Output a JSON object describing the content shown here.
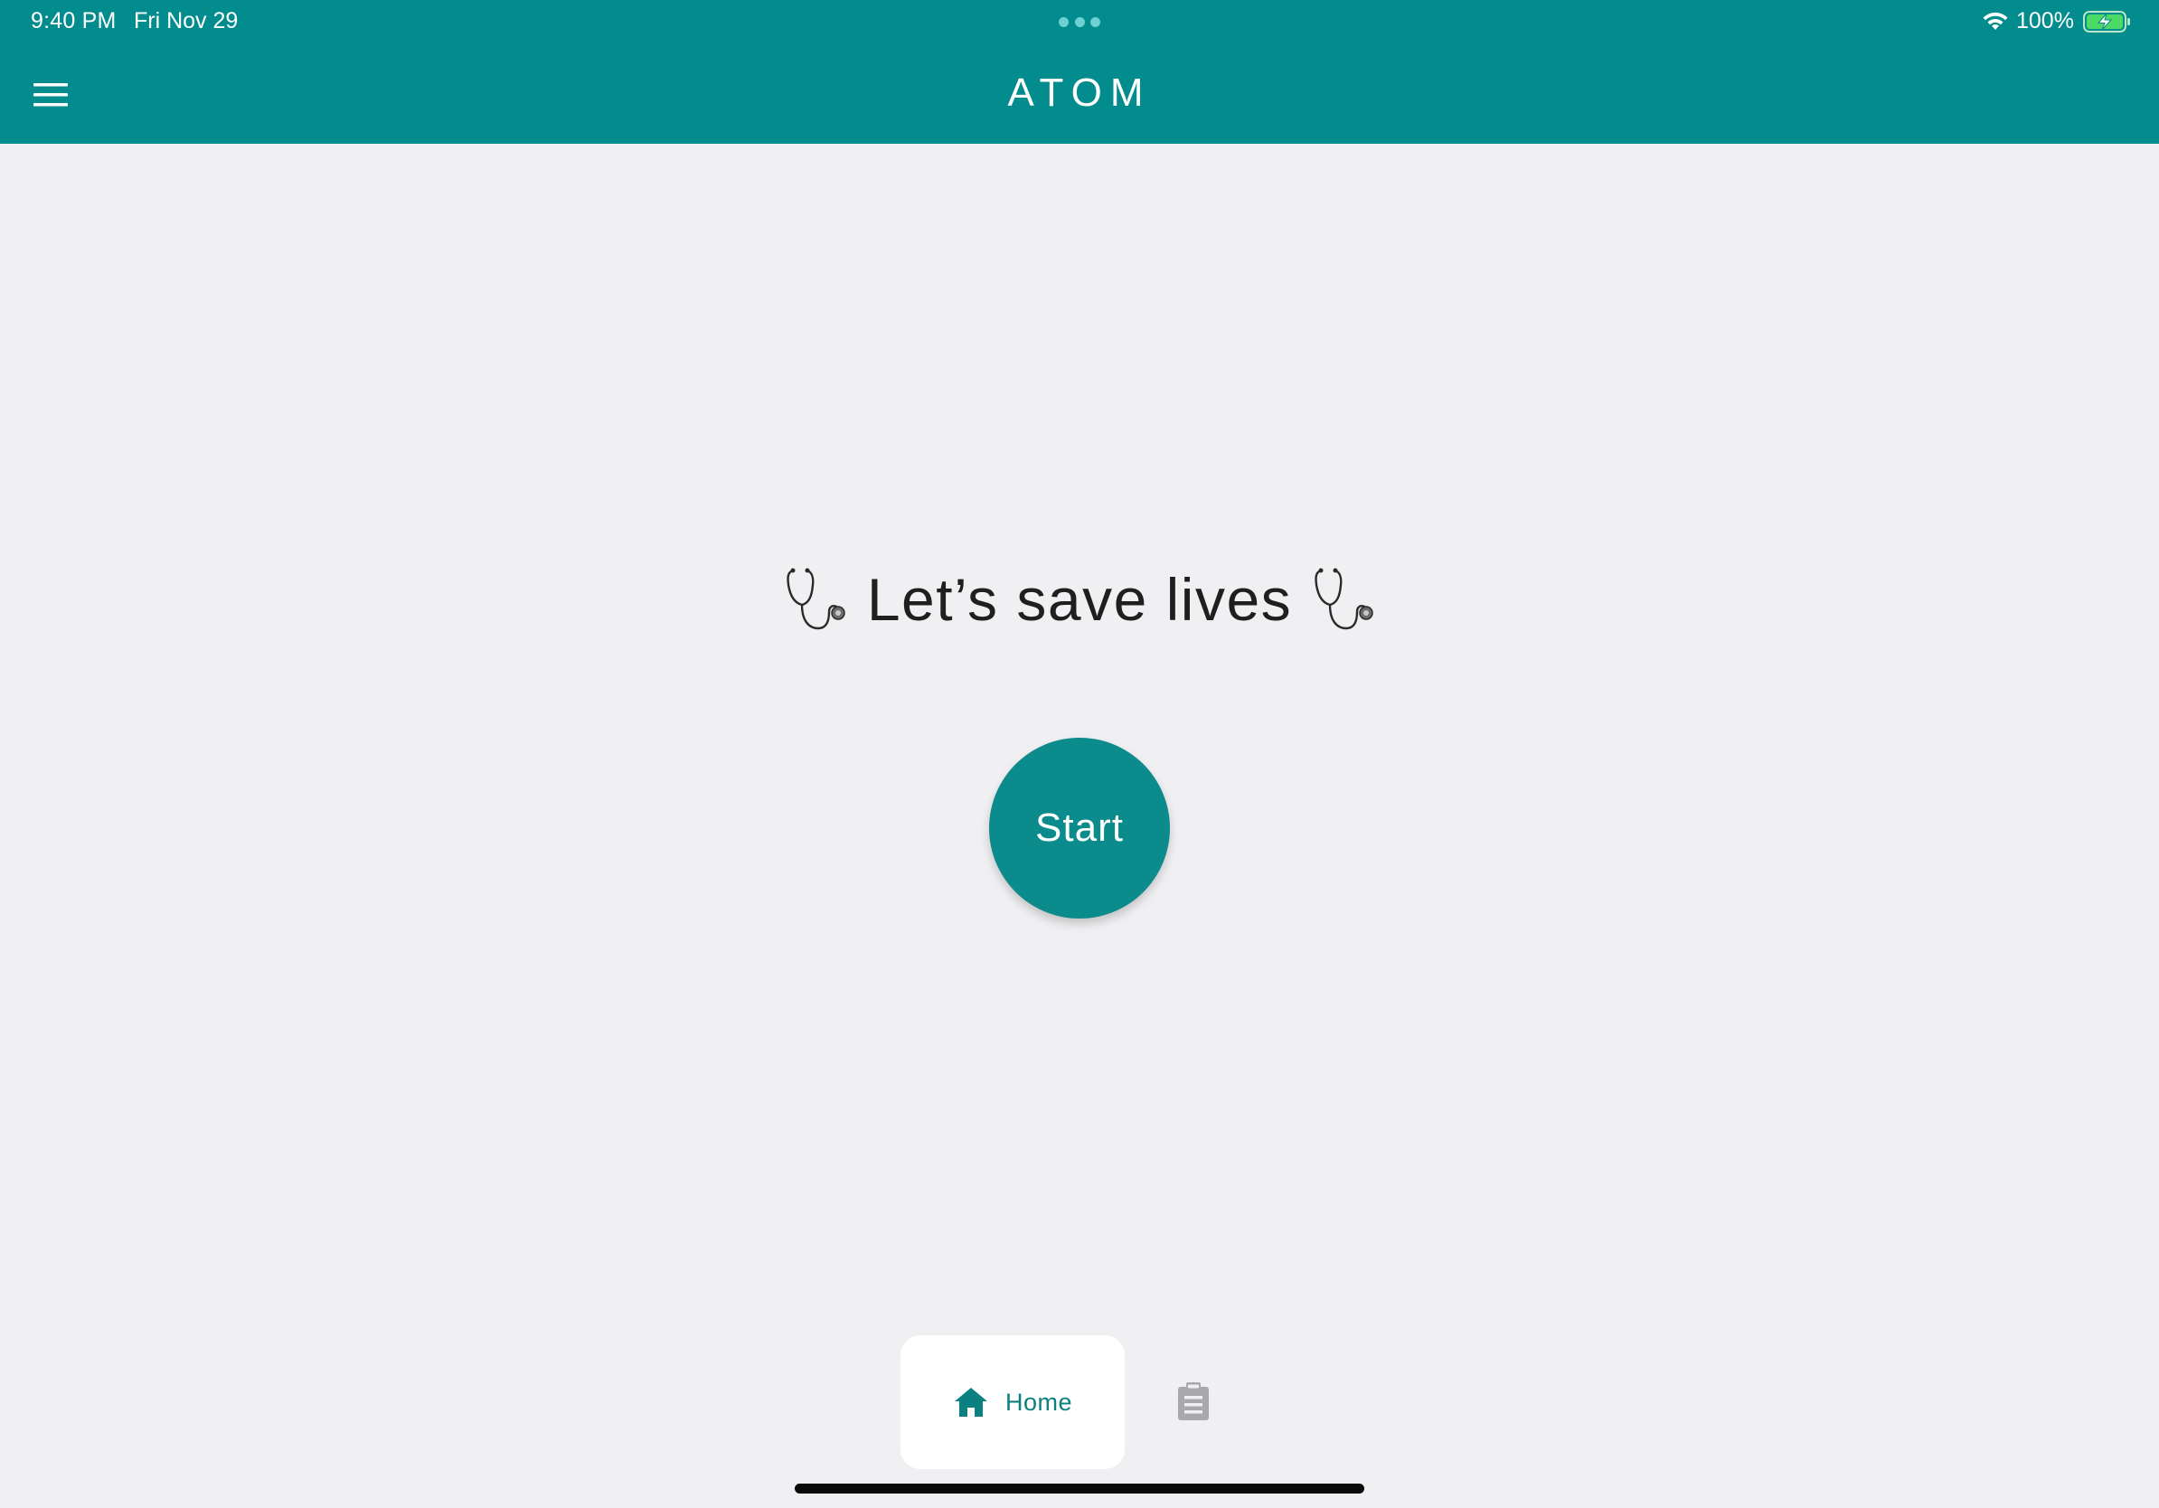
{
  "status_bar": {
    "time": "9:40 PM",
    "date": "Fri Nov 29",
    "battery_percent": "100%",
    "wifi_icon": "wifi-icon",
    "battery_icon": "battery-charging-icon"
  },
  "header": {
    "title": "ATOM",
    "menu_icon": "hamburger-menu-icon",
    "background_color": "#038c8d"
  },
  "hero": {
    "text": "Let’s save lives",
    "left_icon": "stethoscope-icon",
    "right_icon": "stethoscope-icon"
  },
  "start_button": {
    "label": "Start",
    "color": "#0b8b8b"
  },
  "bottom_nav": {
    "items": [
      {
        "label": "Home",
        "icon": "home-icon",
        "active": true
      },
      {
        "label": "",
        "icon": "clipboard-icon",
        "active": false
      }
    ]
  }
}
